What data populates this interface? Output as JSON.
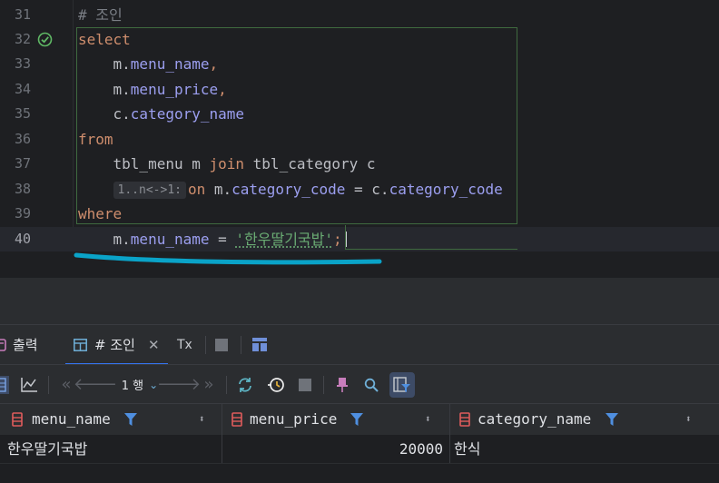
{
  "editor": {
    "lines": [
      {
        "num": "31",
        "comment": "# 조인"
      },
      {
        "num": "32",
        "keyword": "select"
      },
      {
        "num": "33",
        "alias": "m.",
        "field": "menu_name",
        "punct": ","
      },
      {
        "num": "34",
        "alias": "m.",
        "field": "menu_price",
        "punct": ","
      },
      {
        "num": "35",
        "alias": "c.",
        "field": "category_name"
      },
      {
        "num": "36",
        "keyword": "from"
      },
      {
        "num": "37",
        "table1": "tbl_menu m ",
        "keyword": "join",
        "table2": " tbl_category c"
      },
      {
        "num": "38",
        "hint": "1..n<->1:",
        "keyword": "on",
        "alias1": " m.",
        "field1": "category_code",
        "op": " = ",
        "alias2": "c.",
        "field2": "category_code"
      },
      {
        "num": "39",
        "keyword": "where"
      },
      {
        "num": "40",
        "alias": "m.",
        "field": "menu_name",
        "op": " = ",
        "string": "'한우딸기국밥'",
        "punct": ";"
      }
    ],
    "colors": {
      "keyword": "#cf8e6d",
      "field": "#9c9ff0",
      "string": "#6aab73",
      "annotation_stroke": "#0aa3c8"
    }
  },
  "panel": {
    "tabs": [
      {
        "label": "출력",
        "icon": "output-icon"
      },
      {
        "label": "# 조인",
        "icon": "table-icon",
        "active": true
      },
      {
        "label": "Tx",
        "icon": "transaction-icon"
      }
    ],
    "toolbar": {
      "page_label": "1 행"
    },
    "grid": {
      "columns": [
        "menu_name",
        "menu_price",
        "category_name"
      ],
      "rows": [
        [
          "한우딸기국밥",
          "20000",
          "한식"
        ]
      ]
    }
  }
}
